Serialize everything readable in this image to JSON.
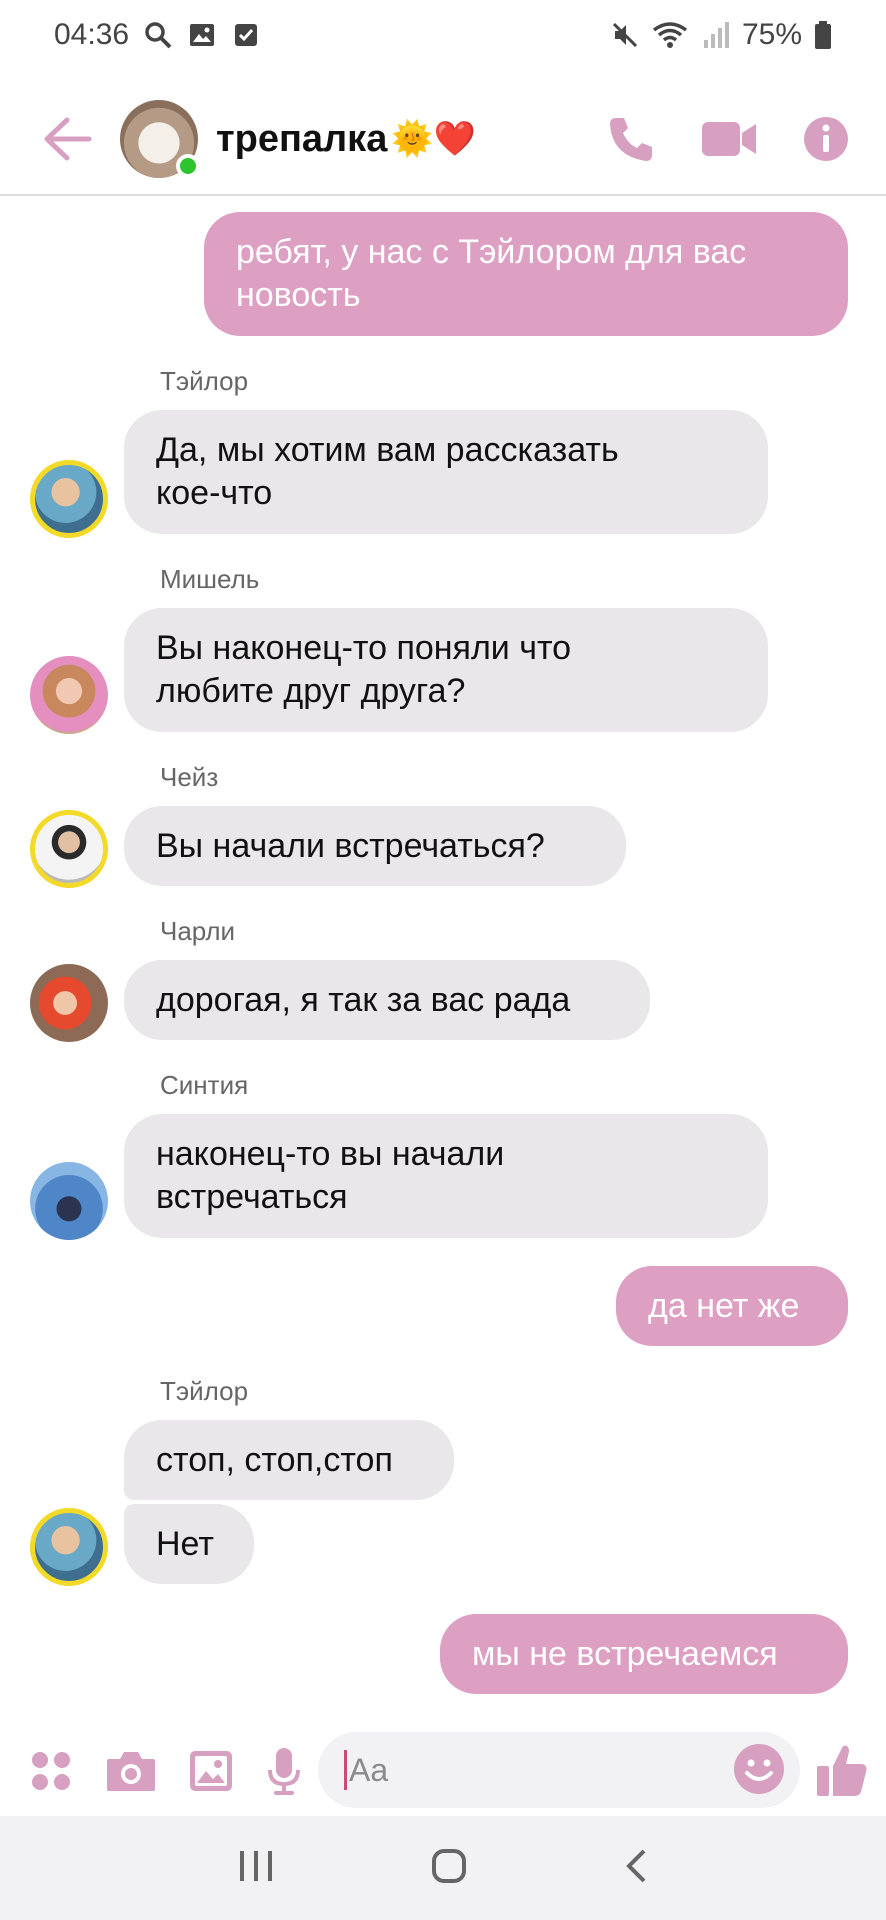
{
  "status_bar": {
    "time": "04:36",
    "battery": "75%"
  },
  "header": {
    "title": "трепалка",
    "title_emoji": "🌞❤️"
  },
  "messages": [
    {
      "type": "out",
      "text_lines": [
        "ребят, у нас с Тэйлором для вас",
        "новость"
      ]
    },
    {
      "type": "in",
      "sender": "Тэйлор",
      "text_lines": [
        "Да, мы хотим вам рассказать",
        "кое-что"
      ]
    },
    {
      "type": "in",
      "sender": "Мишель",
      "text_lines": [
        "Вы наконец-то поняли что",
        "любите друг друга?"
      ]
    },
    {
      "type": "in",
      "sender": "Чейз",
      "text_lines": [
        "Вы начали встречаться?"
      ]
    },
    {
      "type": "in",
      "sender": "Чарли",
      "text_lines": [
        "дорогая, я так за вас рада"
      ]
    },
    {
      "type": "in",
      "sender": "Синтия",
      "text_lines": [
        "наконец-то вы начали",
        "встречаться"
      ]
    },
    {
      "type": "out",
      "text_lines": [
        "да нет же"
      ]
    },
    {
      "type": "in",
      "sender": "Тэйлор",
      "text_lines": [
        "стоп, стоп,стоп"
      ]
    },
    {
      "type": "in",
      "text_lines": [
        "Нет"
      ]
    },
    {
      "type": "out",
      "text_lines": [
        "мы не встречаемся"
      ]
    }
  ],
  "composer": {
    "placeholder": "Aa"
  },
  "colors": {
    "accent": "#dda0c3",
    "incoming_bubble": "#e9e7ea",
    "online": "#2ec42e"
  }
}
